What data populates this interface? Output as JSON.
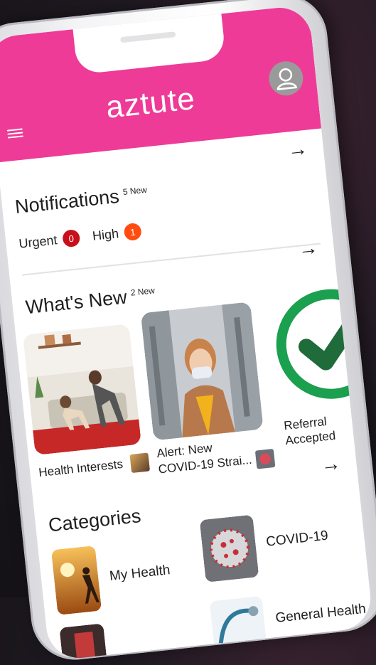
{
  "header": {
    "logo_text": "aztute"
  },
  "notifications": {
    "title": "Notifications",
    "new_count": "5 New",
    "urgent_label": "Urgent",
    "urgent_count": "0",
    "high_label": "High",
    "high_count": "1"
  },
  "whats_new": {
    "title": "What's New",
    "new_count": "2 New",
    "cards": [
      {
        "caption": "Health Interests"
      },
      {
        "caption_line1": "Alert: New",
        "caption_line2": "COVID-19 Strai..."
      },
      {
        "caption_line1": "Referral",
        "caption_line2": "Accepted"
      }
    ]
  },
  "categories": {
    "title": "Categories",
    "items": [
      {
        "label": "My Health"
      },
      {
        "label": "COVID-19"
      },
      {
        "label": "General Health"
      }
    ]
  },
  "colors": {
    "brand": "#ee3b97",
    "urgent": "#c8101c",
    "high": "#ff4d10",
    "check": "#1aa04f"
  },
  "icons": {
    "menu": "menu-icon",
    "avatar": "user-avatar-icon",
    "arrow": "arrow-right-icon",
    "check": "check-icon"
  }
}
